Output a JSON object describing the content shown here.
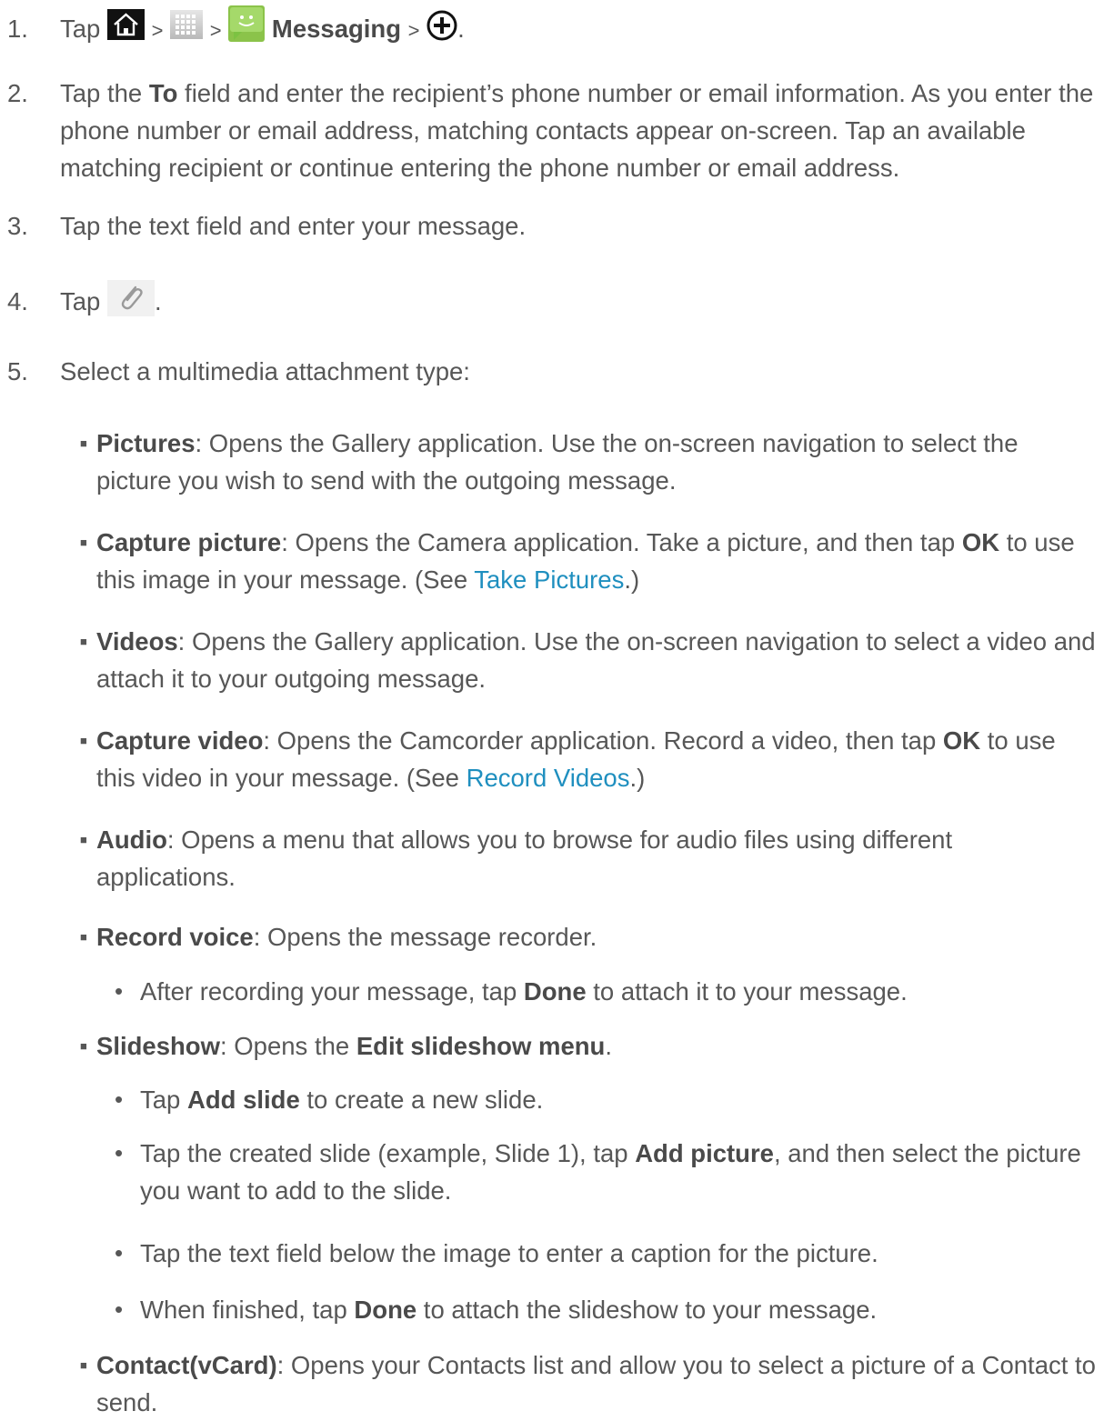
{
  "steps": [
    {
      "num": "1.",
      "tap": "Tap",
      "sep": ">",
      "messaging": "Messaging",
      "end": "."
    },
    {
      "num": "2.",
      "a": "Tap the ",
      "to": "To",
      "b": " field and enter the recipient’s phone number or email information. As you enter the phone number or email address, matching contacts appear on-screen. Tap an available matching recipient or continue entering the phone number or email address."
    },
    {
      "num": "3.",
      "text": "Tap the text field and enter your message."
    },
    {
      "num": "4.",
      "tap": "Tap",
      "end": "."
    },
    {
      "num": "5.",
      "text": "Select a multimedia attachment type:"
    }
  ],
  "items": [
    {
      "bold": "Pictures",
      "text": ": Opens the Gallery application. Use the on-screen navigation to select the picture you wish to send with the outgoing message."
    },
    {
      "bold": "Capture picture",
      "text": ": Opens the Camera application. Take a picture, and then tap ",
      "bold2": "OK",
      "text2": " to use this image in your message. (See ",
      "link": "Take Pictures",
      "text3": ".)"
    },
    {
      "bold": "Videos",
      "text": ": Opens the Gallery application. Use the on-screen navigation to select a video and attach it to your outgoing message."
    },
    {
      "bold": "Capture video",
      "text": ": Opens the Camcorder application. Record a video, then tap ",
      "bold2": "OK",
      "text2": " to use this video in your message. (See ",
      "link": "Record Videos",
      "text3": ".)"
    },
    {
      "bold": "Audio",
      "text": ": Opens a menu that allows you to browse for audio files using different applications."
    },
    {
      "bold": "Record voice",
      "text": ": Opens the message recorder."
    },
    {
      "bold": "Slideshow",
      "text": ": Opens the ",
      "bold2": "Edit slideshow menu",
      "text2": "."
    },
    {
      "bold": "Contact(vCard)",
      "text": ": Opens your Contacts list and allow you to select a picture of a Contact to send."
    }
  ],
  "record_sub": {
    "a": "After recording your message, tap ",
    "b": "Done",
    "c": " to attach it to your message."
  },
  "slideshow_subs": [
    {
      "a": "Tap ",
      "b": "Add slide",
      "c": " to create a new slide."
    },
    {
      "a": "Tap the created slide (example, Slide 1), tap ",
      "b": "Add picture",
      "c": ", and then select the picture you want to add to the slide."
    },
    {
      "a": "Tap the text field below the image to enter a caption for the picture.",
      "b": "",
      "c": ""
    },
    {
      "a": "When finished, tap ",
      "b": "Done",
      "c": " to attach the slideshow to your message."
    }
  ],
  "colors": {
    "text": "#575757",
    "link": "#1f8fbf",
    "messaging_green": "#7cc242"
  },
  "icons": [
    "home-icon",
    "apps-icon",
    "messaging-icon",
    "new-message-plus-icon",
    "paperclip-icon"
  ]
}
